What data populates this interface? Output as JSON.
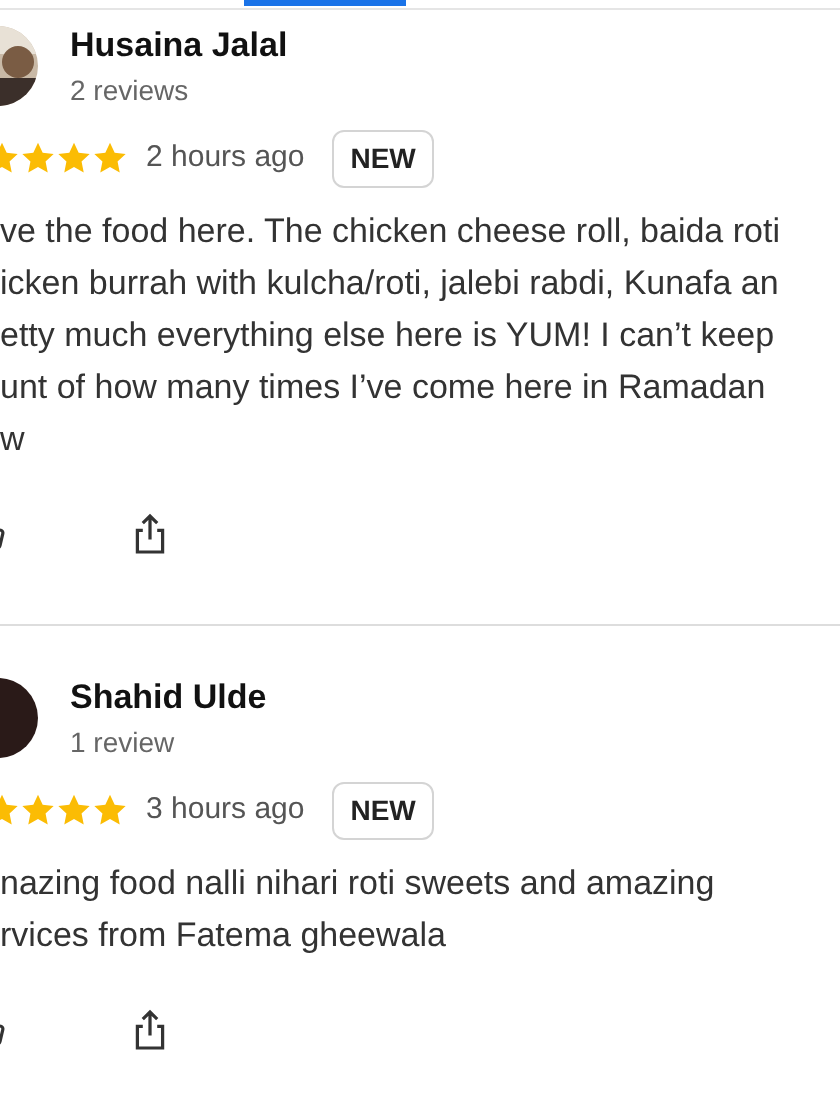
{
  "reviews": [
    {
      "name": "Husaina Jalal",
      "count": "2 reviews",
      "kind": "picture",
      "stars": 4,
      "time": "2 hours ago",
      "badge": "NEW",
      "lines": [
        "ve the food here. The chicken cheese roll, baida roti",
        "icken burrah with kulcha/roti, jalebi rabdi, Kunafa an",
        "etty much everything else here is YUM! I can’t keep",
        "unt of how many times I’ve come here in Ramadan",
        "w"
      ]
    },
    {
      "name": "Shahid Ulde",
      "count": "1 review",
      "kind": "avatar",
      "stars": 4,
      "time": "3 hours ago",
      "badge": "NEW",
      "lines": [
        "nazing food nalli nihari roti sweets and amazing",
        "rvices from Fatema gheewala"
      ]
    }
  ]
}
